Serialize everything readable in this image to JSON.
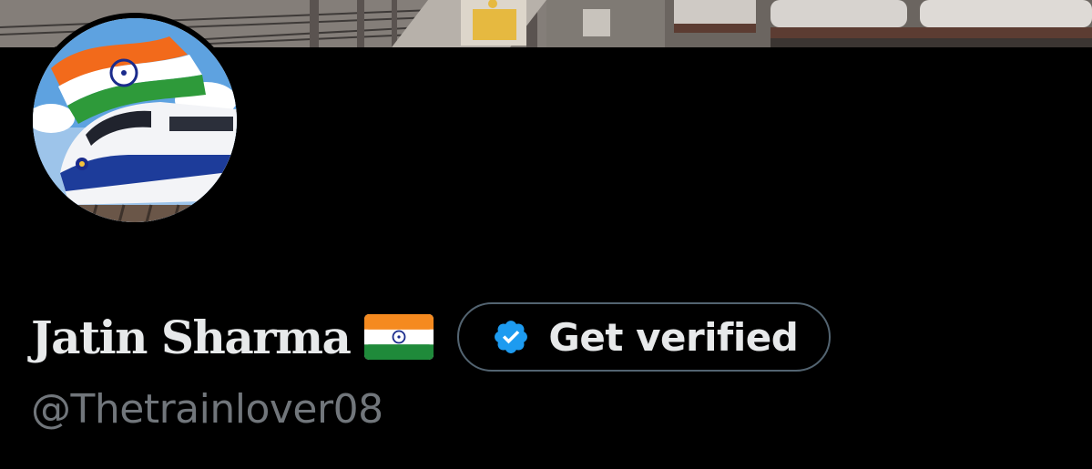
{
  "profile": {
    "display_name": "Jatin Sharma",
    "name_emoji": "indian-flag-emoji",
    "handle": "@Thetrainlover08"
  },
  "actions": {
    "get_verified_label": "Get verified"
  },
  "colors": {
    "background": "#000000",
    "primary_text": "#e7e9ea",
    "secondary_text": "#71767b",
    "verified_badge": "#1d9bf0",
    "button_border": "#536471"
  }
}
